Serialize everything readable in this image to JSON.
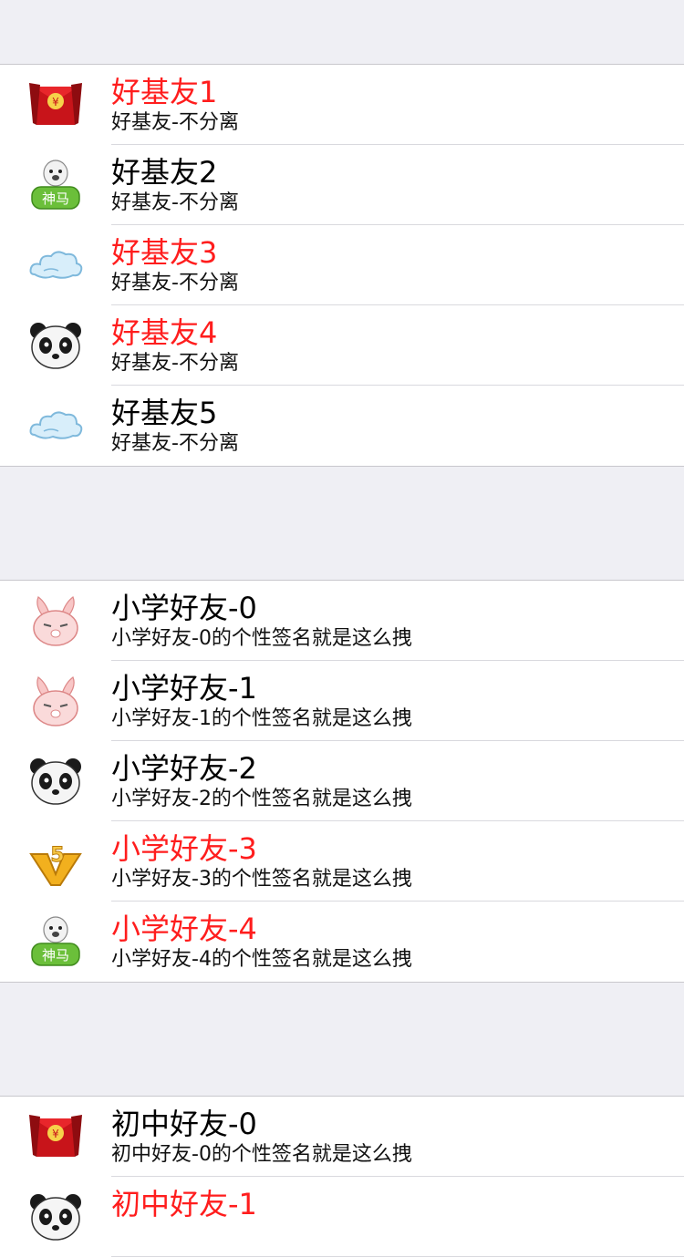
{
  "colors": {
    "vip_name": "#ff1d1d",
    "normal_name": "#000000",
    "background": "#efeff4",
    "cell": "#ffffff"
  },
  "groups": [
    {
      "rows": [
        {
          "name": "好基友1",
          "signature": "好基友-不分离",
          "vip": true,
          "icon": "red-envelope-icon"
        },
        {
          "name": "好基友2",
          "signature": "好基友-不分离",
          "vip": false,
          "icon": "shenma-alpaca-icon"
        },
        {
          "name": "好基友3",
          "signature": "好基友-不分离",
          "vip": true,
          "icon": "cloud-icon"
        },
        {
          "name": "好基友4",
          "signature": "好基友-不分离",
          "vip": true,
          "icon": "panda-icon"
        },
        {
          "name": "好基友5",
          "signature": "好基友-不分离",
          "vip": false,
          "icon": "cloud-icon"
        }
      ]
    },
    {
      "rows": [
        {
          "name": "小学好友-0",
          "signature": "小学好友-0的个性签名就是这么拽",
          "vip": false,
          "icon": "rabbit-icon"
        },
        {
          "name": "小学好友-1",
          "signature": "小学好友-1的个性签名就是这么拽",
          "vip": false,
          "icon": "rabbit-icon"
        },
        {
          "name": "小学好友-2",
          "signature": "小学好友-2的个性签名就是这么拽",
          "vip": false,
          "icon": "panda-icon"
        },
        {
          "name": "小学好友-3",
          "signature": "小学好友-3的个性签名就是这么拽",
          "vip": true,
          "icon": "v5-badge-icon"
        },
        {
          "name": "小学好友-4",
          "signature": "小学好友-4的个性签名就是这么拽",
          "vip": true,
          "icon": "shenma-alpaca-icon"
        }
      ]
    },
    {
      "rows": [
        {
          "name": "初中好友-0",
          "signature": "初中好友-0的个性签名就是这么拽",
          "vip": false,
          "icon": "red-envelope-icon"
        },
        {
          "name": "初中好友-1",
          "signature": "",
          "vip": true,
          "icon": "panda-icon"
        }
      ]
    }
  ]
}
